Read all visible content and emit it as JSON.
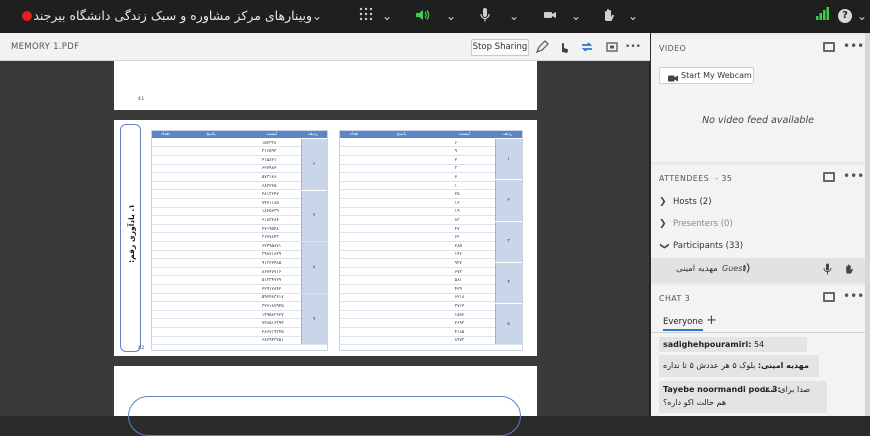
{
  "topbar": {
    "meeting_title": "وبینارهای مرکز مشاوره و سبک زندگی دانشگاه بیرجند",
    "dropdown_glyph": "⌄",
    "grid_glyph": "⁝⁝⁝",
    "help_glyph": "?"
  },
  "document": {
    "filename": "MEMORY 1.PDF",
    "stop_sharing_label": "Stop Sharing",
    "more_glyph": "•••",
    "prev_page_number": "41",
    "page_number": "42",
    "side_label": "۱. یادآوری رقم:",
    "table_headers": [
      "ردیف",
      "لیست",
      "پاسخ",
      "تعداد"
    ],
    "left_table_groups": [
      "۶",
      "۷",
      "۸",
      "۹"
    ],
    "right_table_groups": [
      "۱",
      "۲",
      "۳",
      "۴",
      "۵"
    ],
    "left_table_numbers": [
      "۱۵۲۳۳۸",
      "۳۱۶۵۹۳",
      "۴۱۵۸۲۱",
      "۶۲۷۹۸۴",
      "۵۷۳۱۸۶",
      "۶۸۳۲۲۵",
      "۲۸۱۳۶۴۷",
      "۷۴۲۱۱۸۵",
      "۱۸۲۵۶۳۹",
      "۶۱۸۳۲۸۴",
      "۲۷۱۹۵۴۸",
      "۳۶۷۷۸۴۳",
      "۶۲۳۹۵۸۷۱",
      "۳۹۸۷۱۸۲۹",
      "۹۱۳۶۲۴۸۵",
      "۸۶۷۲۷۷۱۶",
      "۵۱۳۳۴۷۲۹",
      "۲۲۹۱۷۸۴۲",
      "۵۹۲۴۸۳۶۱۷",
      "۳۲۶۱۸۷۹۴۵",
      "۱۴۹۵۸۳۶۲۷",
      "۷۲۸۵۱۶۳۹۴",
      "۲۸۶۷۱۹۳۴۵",
      "۶۸۲۹۴۳۷۵۱"
    ],
    "right_table_numbers": [
      "۶",
      "۹",
      "۲",
      "۳",
      "۷",
      "۱",
      "۲۵",
      "۱۶",
      "۱۹",
      "۸۳",
      "۴۷",
      "۶۲",
      "۲۸۵",
      "۱۴۶",
      "۹۳۷",
      "۶۷۳",
      "۵۸۱",
      "۴۲۹",
      "۶۲۱۸",
      "۳۷۱۴",
      "۱۵۸۲",
      "۲۶۹۳",
      "۴۱۸۵",
      "۸۹۷۳"
    ]
  },
  "video_pod": {
    "title": "VIDEO",
    "webcam_label": "Start My Webcam",
    "no_feed": "No video feed available"
  },
  "attendees_pod": {
    "title": "ATTENDEES",
    "count": "- 35",
    "hosts": "Hosts (2)",
    "presenters": "Presenters (0)",
    "participants": "Participants (33)",
    "attendee_name": "مهدیه امینی",
    "attendee_role": "Guest"
  },
  "chat_pod": {
    "title": "CHAT",
    "count": "3",
    "tab_everyone": "Everyone",
    "add_tab_glyph": "+",
    "messages": [
      {
        "sender": "sadighehpouramiri:",
        "text": "54"
      },
      {
        "sender": "مهدیه امینی:",
        "text": "بلوک ۵ هر عددش ۵ تا نداره"
      },
      {
        "sender": "Tayebe noormandi poor 3:",
        "text": "صدا برای شما"
      },
      {
        "sender": "",
        "text": "هم حالت اکو داره؟"
      }
    ]
  },
  "colors": {
    "topbar_bg": "#1f1f1f",
    "record_red": "#e02020",
    "mic_green": "#3fcb4b",
    "table_header_blue": "#5b85c4",
    "share_blue": "#2a77d4"
  }
}
